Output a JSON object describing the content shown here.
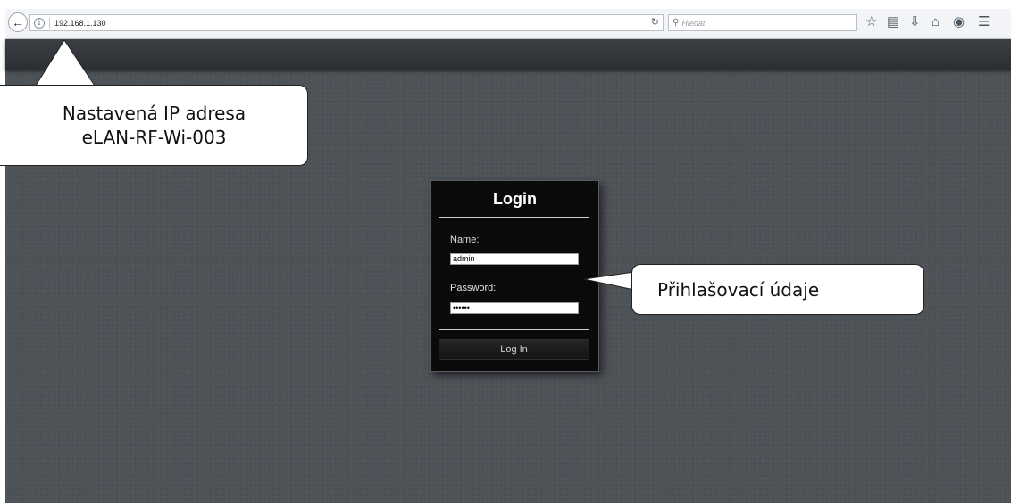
{
  "browser": {
    "url": "192.168.1.130",
    "search_placeholder": "Hledat",
    "icons": [
      "back-arrow-icon",
      "info-icon",
      "reload-icon",
      "search-icon",
      "bookmark-star-icon",
      "reading-list-icon",
      "download-icon",
      "home-icon",
      "chat-icon",
      "menu-icon"
    ]
  },
  "login": {
    "title": "Login",
    "name_label": "Name:",
    "name_value": "admin",
    "password_label": "Password:",
    "password_value": "••••••",
    "button_label": "Log In"
  },
  "callouts": {
    "ip_line1": "Nastavená IP adresa",
    "ip_line2": "eLAN-RF-Wi-003",
    "credentials": "Přihlašovací údaje"
  },
  "colors": {
    "page_background": "#4d5257",
    "dialog_background": "#0a0a0a"
  }
}
